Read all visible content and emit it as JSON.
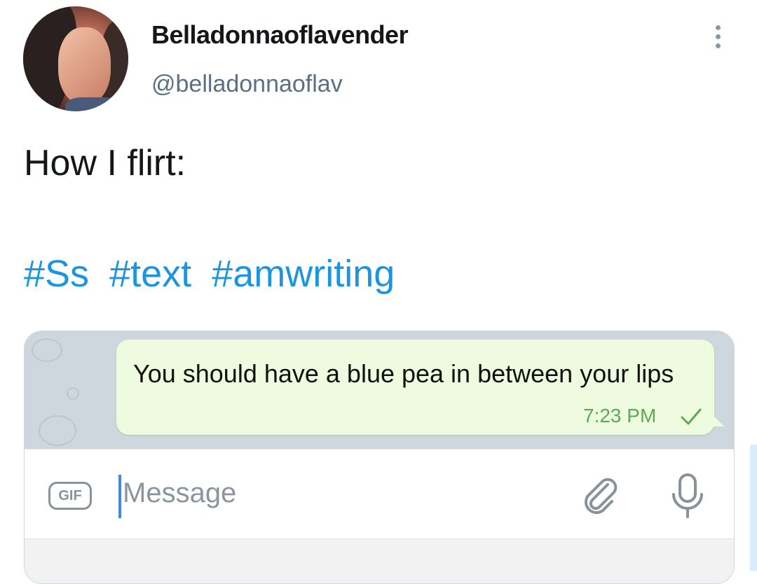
{
  "tweet": {
    "display_name": "Belladonnaoflavender",
    "handle": "@belladonnaoflav",
    "text": "How I flirt:",
    "hashtags": [
      "#Ss",
      "#text",
      "#amwriting"
    ]
  },
  "embedded_chat": {
    "message": "You should have a blue pea in between your lips",
    "time": "7:23 PM",
    "input_placeholder": "Message",
    "gif_label": "GIF",
    "bubble_color": "#eefbdf",
    "time_color": "#5fa859"
  },
  "colors": {
    "hashtag": "#1b95e0",
    "handle": "#5b7083",
    "text": "#14171a"
  },
  "icons": {
    "more": "more-vertical-icon",
    "check": "checkmark-icon",
    "attach": "paperclip-icon",
    "mic": "microphone-icon"
  }
}
